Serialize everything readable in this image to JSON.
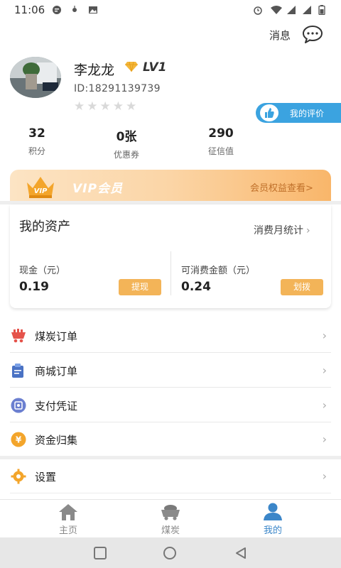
{
  "status_bar": {
    "time": "11:06"
  },
  "header": {
    "messages_label": "消息"
  },
  "profile": {
    "name": "李龙龙",
    "level": "LV1",
    "id_text": "ID:18291139739",
    "rating_stars": 0,
    "rating_max": 5,
    "evaluation_label": "我的评价"
  },
  "stats": [
    {
      "value": "32",
      "label": "积分"
    },
    {
      "value": "0张",
      "label": "优惠券"
    },
    {
      "value": "290",
      "label": "征信值"
    }
  ],
  "vip": {
    "title": "VIP会员",
    "link": "会员权益查看>",
    "badge": "VIP"
  },
  "assets": {
    "title": "我的资产",
    "stats_link": "消费月统计",
    "cash": {
      "label": "现金（元）",
      "value": "0.19",
      "button": "提现"
    },
    "spendable": {
      "label": "可消费金额（元）",
      "value": "0.24",
      "button": "划拨"
    }
  },
  "menu": [
    {
      "label": "煤炭订单",
      "icon": "coal-cart-icon"
    },
    {
      "label": "商城订单",
      "icon": "mall-order-icon"
    },
    {
      "label": "支付凭证",
      "icon": "payment-voucher-icon"
    },
    {
      "label": "资金归集",
      "icon": "fund-collection-icon"
    }
  ],
  "settings": {
    "label": "设置",
    "icon": "gear-icon"
  },
  "bottom_nav": [
    {
      "label": "主页",
      "icon": "home-icon",
      "active": false
    },
    {
      "label": "煤炭",
      "icon": "coal-cart-icon",
      "active": false
    },
    {
      "label": "我的",
      "icon": "user-icon",
      "active": true
    }
  ],
  "colors": {
    "accent_blue": "#3b86c9",
    "button_orange": "#f3b458",
    "vip_gradient_end": "#f9b66a"
  }
}
